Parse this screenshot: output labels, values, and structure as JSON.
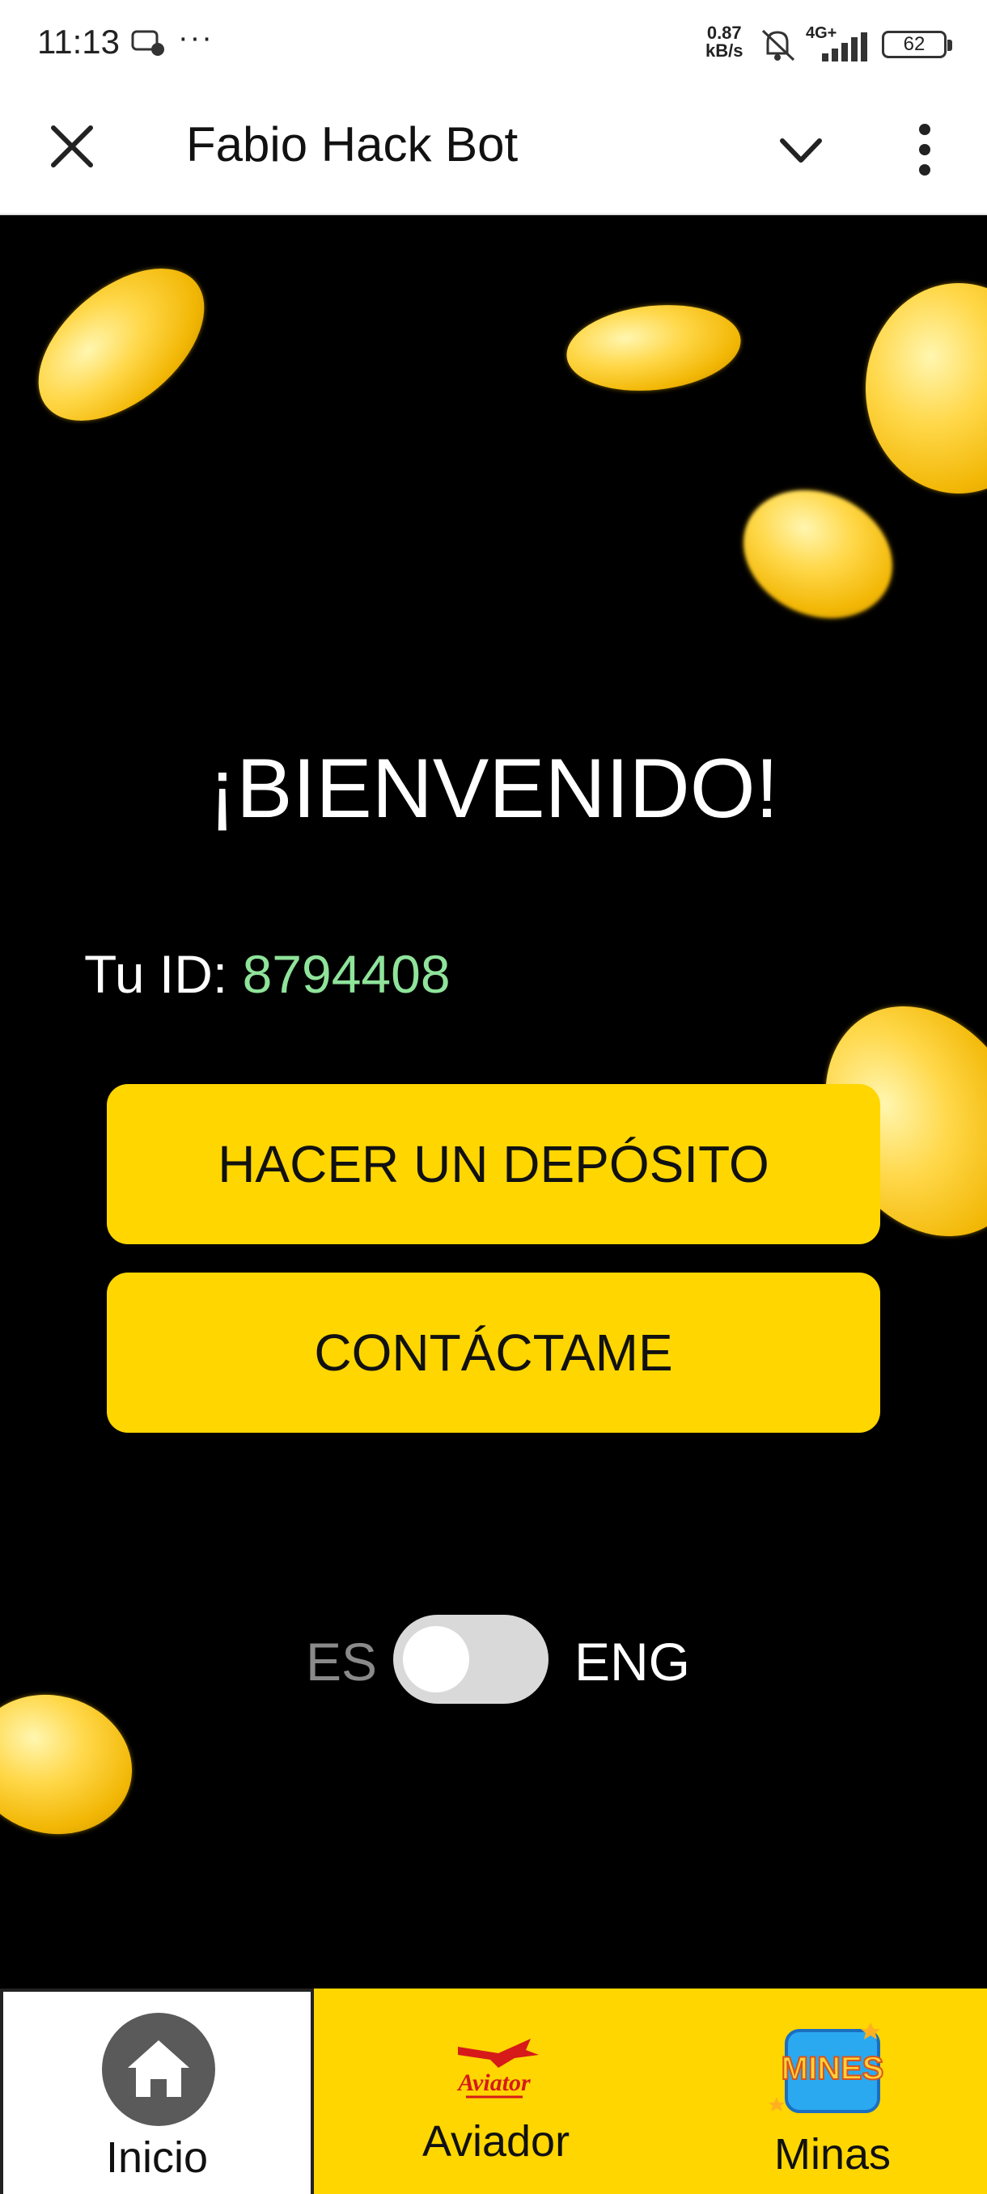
{
  "status_bar": {
    "time": "11:13",
    "dots": "···",
    "net_speed_value": "0.87",
    "net_speed_unit": "kB/s",
    "network": "4G+",
    "battery": "62"
  },
  "app_bar": {
    "title": "Fabio Hack Bot"
  },
  "main": {
    "welcome": "¡BIENVENIDO!",
    "id_label": "Tu ID: ",
    "id_value": "8794408",
    "deposit_button": "HACER UN DEPÓSITO",
    "contact_button": "CONTÁCTAME",
    "lang_left": "ES",
    "lang_right": "ENG",
    "lang_selected": "ES"
  },
  "bottom_nav": {
    "items": [
      {
        "label": "Inicio",
        "icon": "home-icon",
        "active": true
      },
      {
        "label": "Aviador",
        "icon": "aviator-logo"
      },
      {
        "label": "Minas",
        "icon": "mines-logo"
      }
    ]
  },
  "logos": {
    "aviator": "Aviator",
    "mines": "MINES"
  },
  "colors": {
    "accent_yellow": "#ffd600",
    "id_green": "#8fe39a",
    "background": "#000000"
  }
}
